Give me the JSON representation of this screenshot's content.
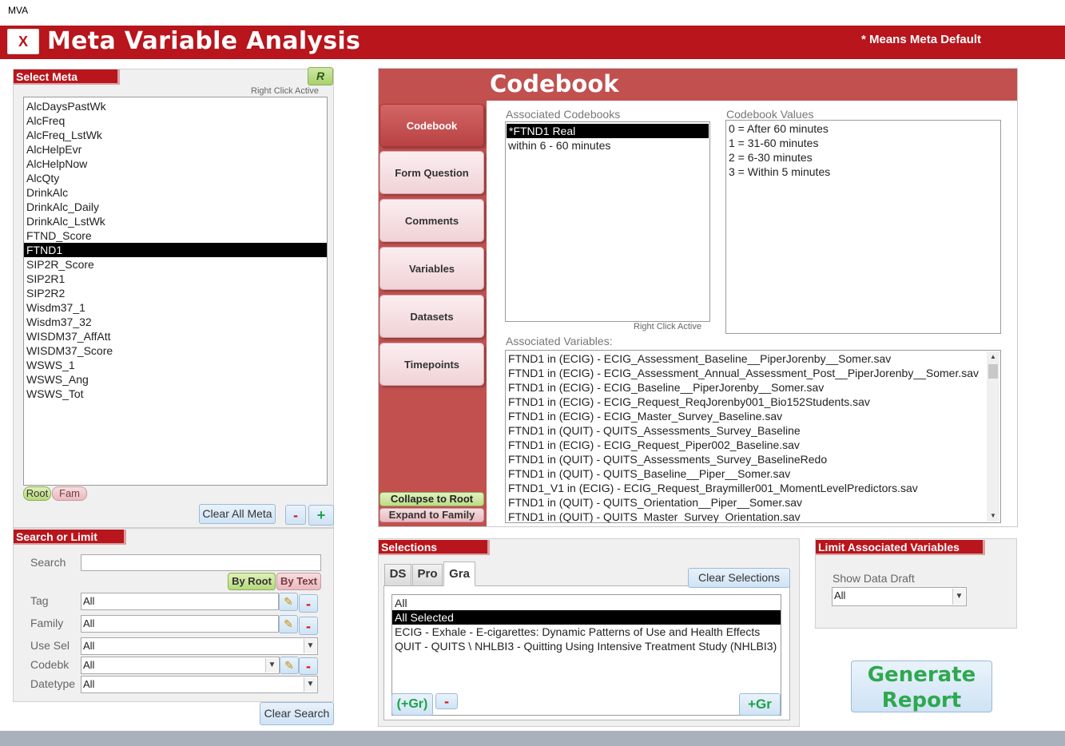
{
  "app": {
    "window_title": "MVA",
    "close_label": "X",
    "title": "Meta Variable Analysis",
    "meta_default_note": "* Means Meta Default"
  },
  "select_meta": {
    "label": "Select Meta",
    "r_button": "R",
    "right_click_note": "Right Click Active",
    "items": [
      "AlcDaysPastWk",
      "AlcFreq",
      "AlcFreq_LstWk",
      "AlcHelpEvr",
      "AlcHelpNow",
      "AlcQty",
      "DrinkAlc",
      "DrinkAlc_Daily",
      "DrinkAlc_LstWk",
      "FTND_Score",
      "FTND1",
      "SIP2R_Score",
      "SIP2R1",
      "SIP2R2",
      "Wisdm37_1",
      "Wisdm37_32",
      "WISDM37_AffAtt",
      "WISDM37_Score",
      "WSWS_1",
      "WSWS_Ang",
      "WSWS_Tot"
    ],
    "selected_item": "FTND1",
    "root_pill": "Root",
    "fam_pill": "Fam",
    "clear_all": "Clear All Meta",
    "minus": "-",
    "plus": "+"
  },
  "search": {
    "label": "Search or Limit",
    "search_label": "Search",
    "search_value": "",
    "by_root": "By Root",
    "by_text": "By Text",
    "tag_label": "Tag",
    "tag_value": "All",
    "family_label": "Family",
    "family_value": "All",
    "use_sel_label": "Use Sel",
    "use_sel_value": "All",
    "codebk_label": "Codebk",
    "codebk_value": "All",
    "datetype_label": "Datetype",
    "datetype_value": "All",
    "minus": "-",
    "clear_search": "Clear Search"
  },
  "codebook": {
    "title": "Codebook",
    "nav": [
      "Codebook",
      "Form Question",
      "Comments",
      "Variables",
      "Datasets",
      "Timepoints"
    ],
    "collapse": "Collapse to Root",
    "expand": "Expand to Family",
    "assoc_codebooks_label": "Associated Codebooks",
    "assoc_codebooks": [
      "*FTND1 Real",
      "within 6 - 60 minutes"
    ],
    "right_click_note": "Right Click Active",
    "codebook_values_label": "Codebook Values",
    "codebook_values": [
      "0 = After 60 minutes",
      "1 = 31-60 minutes",
      "2 = 6-30 minutes",
      "3 = Within 5 minutes"
    ],
    "assoc_variables_label": "Associated Variables:",
    "assoc_variables": [
      "FTND1 in (ECIG) - ECIG_Assessment_Baseline__PiperJorenby__Somer.sav",
      "FTND1 in (ECIG) - ECIG_Assessment_Annual_Assessment_Post__PiperJorenby__Somer.sav",
      "FTND1 in (ECIG) - ECIG_Baseline__PiperJorenby__Somer.sav",
      "FTND1 in (ECIG) - ECIG_Request_ReqJorenby001_Bio152Students.sav",
      "FTND1 in (ECIG) - ECIG_Master_Survey_Baseline.sav",
      "FTND1 in (QUIT) - QUITS_Assessments_Survey_Baseline",
      "FTND1 in (ECIG) - ECIG_Request_Piper002_Baseline.sav",
      "FTND1 in (QUIT) - QUITS_Assessments_Survey_BaselineRedo",
      "FTND1 in (QUIT) - QUITS_Baseline__Piper__Somer.sav",
      "FTND1_V1 in (ECIG) - ECIG_Request_Braymiller001_MomentLevelPredictors.sav",
      "FTND1 in (QUIT) - QUITS_Orientation__Piper__Somer.sav",
      "FTND1 in (QUIT) - QUITS_Master_Survey_Orientation.sav"
    ],
    "scroll_up": "▲",
    "scroll_down": "▼"
  },
  "selections": {
    "label": "Selections",
    "tabs": [
      "DS",
      "Pro",
      "Gra"
    ],
    "active_tab": "Gra",
    "clear": "Clear Selections",
    "items": [
      "All",
      "All Selected",
      "ECIG - Exhale - E-cigarettes: Dynamic Patterns of Use and Health Effects",
      "QUIT - QUITS \\ NHLBI3 - Quitting Using Intensive Treatment Study (NHLBI3)"
    ],
    "selected_item": "All Selected",
    "add_group_paren": "(+Gr)",
    "minus": "-",
    "add_group": "+Gr"
  },
  "limit": {
    "label": "Limit Associated Variables",
    "show_draft_label": "Show Data Draft",
    "show_draft_value": "All"
  },
  "generate": {
    "line1": "Generate",
    "line2": "Report"
  },
  "colors": {
    "brand_red": "#b8151c",
    "codebook_red": "#c1504f",
    "accent_green": "#2fa84f"
  }
}
